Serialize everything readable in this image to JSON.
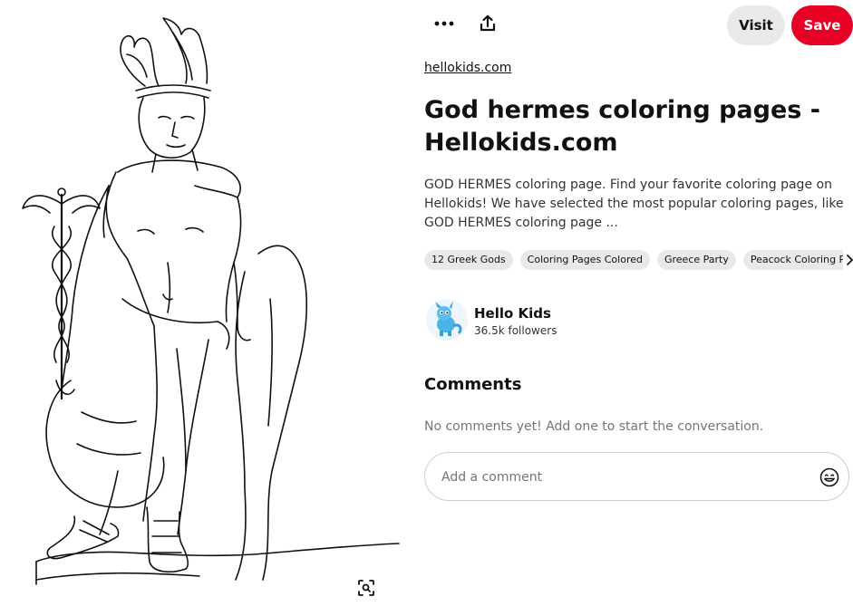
{
  "pin": {
    "image_alt": "Hermes coloring page line drawing",
    "source": "hellokids.com",
    "title": "God hermes coloring pages - Hellokids.com",
    "description": "GOD HERMES coloring page. Find your favorite coloring page on Hellokids! We have selected the most popular coloring pages, like GOD HERMES coloring page ..."
  },
  "actions": {
    "more_icon": "more-horizontal-icon",
    "share_icon": "share-upload-icon",
    "visit_label": "Visit",
    "save_label": "Save",
    "lens_icon": "visual-search-icon"
  },
  "tags": [
    {
      "label": "12 Greek Gods"
    },
    {
      "label": "Coloring Pages Colored"
    },
    {
      "label": "Greece Party"
    },
    {
      "label": "Peacock Coloring Pag"
    }
  ],
  "author": {
    "name": "Hello Kids",
    "followers": "36.5k followers"
  },
  "comments": {
    "heading": "Comments",
    "empty_text": "No comments yet! Add one to start the conversation.",
    "placeholder": "Add a comment",
    "emoji_icon": "emoji-smile-icon"
  },
  "colors": {
    "save": "#e60023",
    "visit": "#e9e9e9",
    "tag_bg": "#e9e9e9"
  }
}
